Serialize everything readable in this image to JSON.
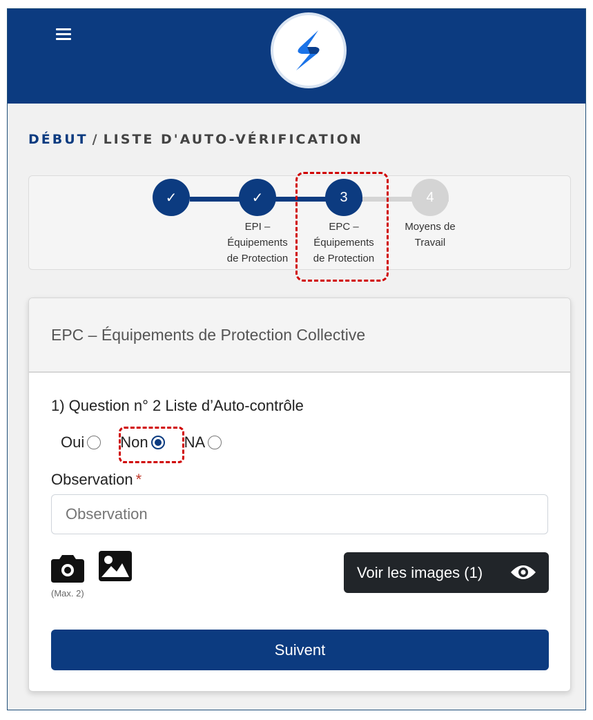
{
  "header": {
    "menu_icon": "hamburger-icon",
    "logo": "s-logo"
  },
  "breadcrumb": {
    "home": "DÉBUT",
    "separator": "/",
    "current": "LISTE D'AUTO-VÉRIFICATION"
  },
  "stepper": {
    "steps": [
      {
        "state": "done",
        "marker": "✓",
        "label": []
      },
      {
        "state": "done",
        "marker": "✓",
        "label": [
          "EPI –",
          "Équipements",
          "de Protection"
        ]
      },
      {
        "state": "active",
        "marker": "3",
        "label": [
          "EPC –",
          "Équipements",
          "de Protection"
        ]
      },
      {
        "state": "todo",
        "marker": "4",
        "label": [
          "Moyens de",
          "Travail"
        ]
      }
    ]
  },
  "card": {
    "title": "EPC – Équipements de Protection Collective",
    "question": "1) Question n° 2 Liste d’Auto-contrôle",
    "options": [
      {
        "label": "Oui",
        "checked": false
      },
      {
        "label": "Non",
        "checked": true
      },
      {
        "label": "NA",
        "checked": false
      }
    ],
    "observation_label": "Observation",
    "observation_required_mark": "*",
    "observation_placeholder": "Observation",
    "observation_value": "",
    "camera_icon": "camera-icon",
    "gallery_icon": "image-icon",
    "max_note": "(Max. 2)",
    "view_images_label": "Voir les images (1)",
    "view_icon": "eye-icon",
    "next_label": "Suivent"
  },
  "colors": {
    "brand": "#0c3b80",
    "highlight": "#d00000",
    "dark_button": "#212529"
  }
}
